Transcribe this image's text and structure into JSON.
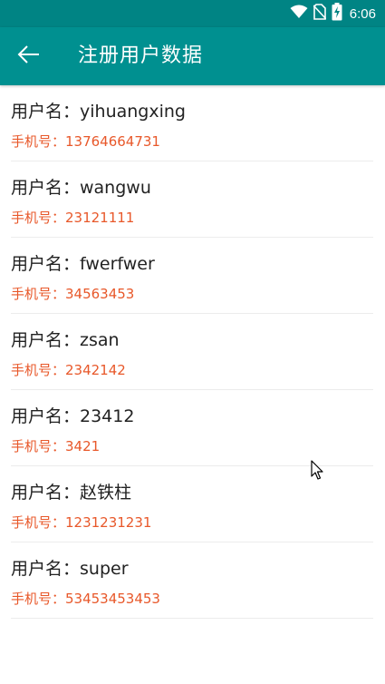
{
  "status_bar": {
    "time": "6:06",
    "icons": [
      "wifi-icon",
      "no-sim-icon",
      "battery-charging-icon"
    ]
  },
  "app_bar": {
    "title": "注册用户数据",
    "back_icon": "arrow-left-icon"
  },
  "users": [
    {
      "name_label": "用户名：yihuangxing",
      "phone_label": "手机号：13764664731"
    },
    {
      "name_label": "用户名：wangwu",
      "phone_label": "手机号：23121111"
    },
    {
      "name_label": "用户名：fwerfwer",
      "phone_label": "手机号：34563453"
    },
    {
      "name_label": "用户名：zsan",
      "phone_label": "手机号：2342142"
    },
    {
      "name_label": "用户名：23412",
      "phone_label": "手机号：3421"
    },
    {
      "name_label": "用户名：赵铁柱",
      "phone_label": "手机号：1231231231"
    },
    {
      "name_label": "用户名：super",
      "phone_label": "手机号：53453453453"
    }
  ],
  "colors": {
    "app_bar": "#009090",
    "status_bar": "#008484",
    "phone_text": "#e8582a",
    "name_text": "#222222"
  }
}
